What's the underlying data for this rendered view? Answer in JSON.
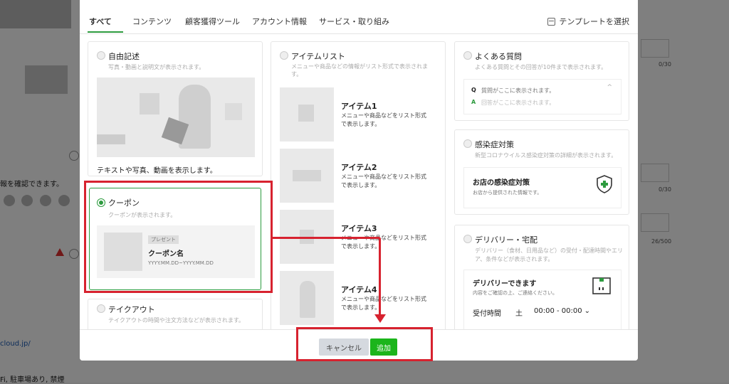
{
  "background": {
    "confirm_text": "報を確認できます。",
    "link_text": "cloud.jp/",
    "bottom_text": "Fi, 駐車場あり, 禁煙",
    "counts": [
      "0/30",
      "0/30",
      "26/500"
    ]
  },
  "tabs": [
    {
      "label": "すべて",
      "active": true
    },
    {
      "label": "コンテンツ",
      "active": false
    },
    {
      "label": "顧客獲得ツール",
      "active": false
    },
    {
      "label": "アカウント情報",
      "active": false
    },
    {
      "label": "サービス・取り組み",
      "active": false
    }
  ],
  "template_button": "テンプレートを選択",
  "cards": {
    "free": {
      "title": "自由記述",
      "desc": "写真・動画と説明文が表示されます。",
      "caption": "テキストや写真、動画を表示します。"
    },
    "coupon": {
      "title": "クーポン",
      "desc": "クーポンが表示されます。",
      "badge": "プレゼント",
      "name": "クーポン名",
      "dates": "YYYY.MM.DD~YYYY.MM.DD"
    },
    "takeout": {
      "title": "テイクアウト",
      "desc": "テイクアウトの時間や注文方法などが表示されます。"
    },
    "itemlist": {
      "title": "アイテムリスト",
      "desc": "メニューや商品などの情報がリスト形式で表示されま",
      "desc2": "す。",
      "items": [
        {
          "title": "アイテム1",
          "line1": "メニューや商品などをリスト形式",
          "line2": "で表示します。"
        },
        {
          "title": "アイテム2",
          "line1": "メニューや商品などをリスト形式",
          "line2": "で表示します。"
        },
        {
          "title": "アイテム3",
          "line1": "メニューや商品などをリスト形式",
          "line2": "で表示します。"
        },
        {
          "title": "アイテム4",
          "line1": "メニューや商品などをリスト形式",
          "line2": "で表示します。"
        }
      ]
    },
    "faq": {
      "title": "よくある質問",
      "desc": "よくある質問とその回答が10件まで表示されます。",
      "q_label": "Q",
      "q_text": "質問がここに表示されます。",
      "a_label": "A",
      "a_text": "回答がここに表示されます。"
    },
    "infection": {
      "title": "感染症対策",
      "desc": "新型コロナウイルス感染症対策の詳細が表示されます。",
      "box_title": "お店の感染症対策",
      "box_desc": "お店から提供された情報です。"
    },
    "delivery": {
      "title": "デリバリー・宅配",
      "desc": "デリバリー（食材、日用品など）の受付・配達時間やエリ",
      "desc2": "ア、条件などが表示されます。",
      "box_title": "デリバリーできます",
      "box_desc": "内容をご確認の上、ご連絡ください。",
      "hours_label": "受付時間",
      "day": "土",
      "time": "00:00 - 00:00"
    }
  },
  "footer": {
    "cancel": "キャンセル",
    "add": "追加"
  },
  "colors": {
    "accent": "#2d9b3f",
    "highlight": "#d7222f"
  }
}
